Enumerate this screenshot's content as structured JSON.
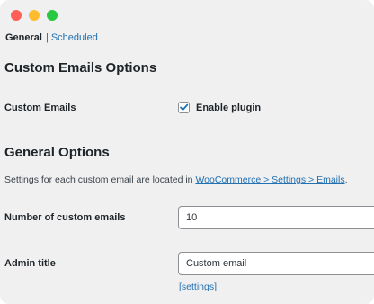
{
  "colors": {
    "background": "#f0f0f1",
    "link": "#2271b1",
    "text": "#1d2327",
    "traffic_close": "#ff5f57",
    "traffic_minimize": "#febc2e",
    "traffic_maximize": "#28c840"
  },
  "subnav": {
    "current": "General",
    "separator": "|",
    "other": "Scheduled"
  },
  "custom_emails_options": {
    "heading": "Custom Emails Options",
    "custom_emails_label": "Custom Emails",
    "enable_plugin_label": "Enable plugin",
    "enable_plugin_checked": true
  },
  "general_options": {
    "heading": "General Options",
    "description_prefix": "Settings for each custom email are located in ",
    "description_link": "WooCommerce > Settings > Emails",
    "description_suffix": ".",
    "number_label": "Number of custom emails",
    "number_value": "10",
    "admin_title_label": "Admin title",
    "admin_title_value": "Custom email",
    "settings_link": "[settings]"
  }
}
